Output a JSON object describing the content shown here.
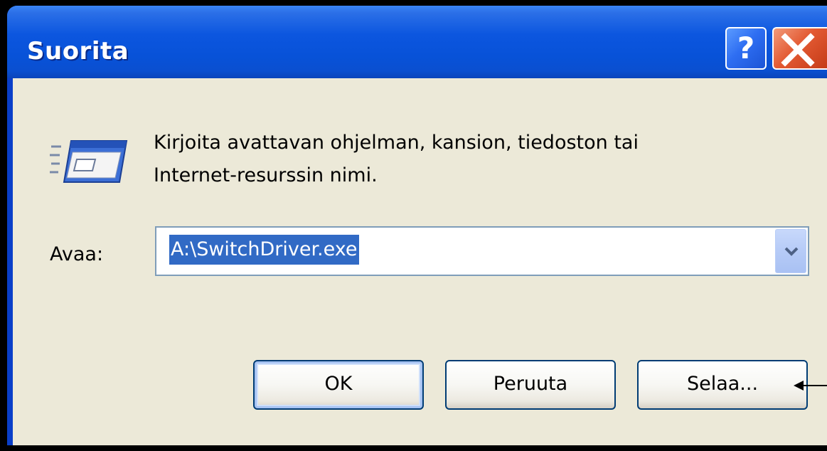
{
  "window": {
    "title": "Suorita",
    "help_icon": "question-mark-icon",
    "close_icon": "close-x-icon",
    "help_glyph": "?"
  },
  "body": {
    "icon": "run-window-icon",
    "prompt_line1": "Kirjoita avattavan ohjelman, kansion, tiedoston tai",
    "prompt_line2": "Internet-resurssin nimi.",
    "open_label": "Avaa:",
    "open_value": "A:\\SwitchDriver.exe",
    "dropdown_icon": "chevron-down-icon"
  },
  "buttons": {
    "ok": "OK",
    "cancel": "Peruuta",
    "browse": "Selaa..."
  },
  "annotation": {
    "icon": "arrow-left-icon"
  },
  "colors": {
    "titlebar": "#0a52d8",
    "client_bg": "#ece9d8",
    "selection": "#316ac5",
    "close_button": "#e35a33",
    "button_border": "#003c74"
  }
}
